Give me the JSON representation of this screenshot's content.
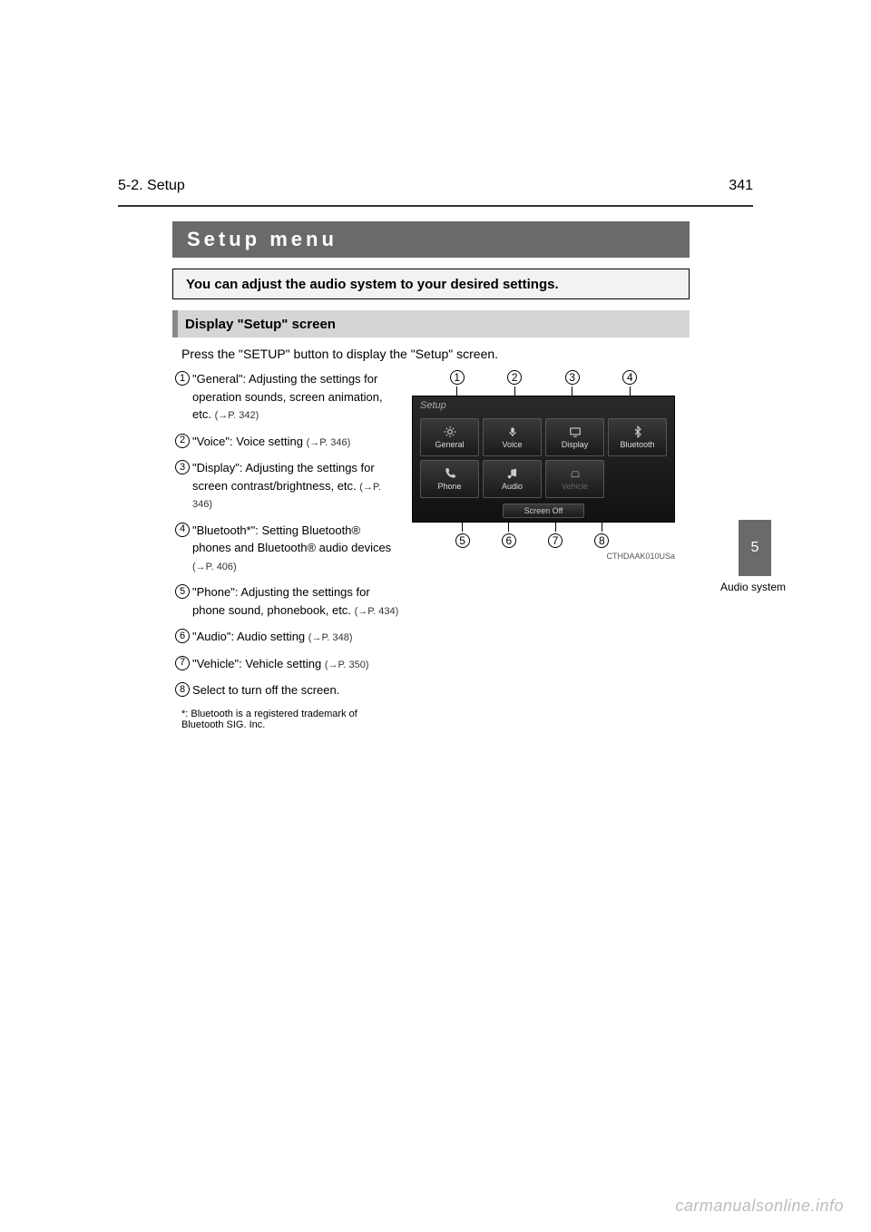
{
  "header": {
    "page_number": "341",
    "section": "5-2. Setup"
  },
  "title": "Setup menu",
  "intro": "You can adjust the audio system to your desired settings.",
  "section_heading": "Display \"Setup\" screen",
  "press_line": "Press the \"SETUP\" button to display the \"Setup\" screen.",
  "items": [
    {
      "n": "1",
      "text": "\"General\": Adjusting the settings for operation sounds, screen animation, etc.",
      "ref": "(→P. 342)"
    },
    {
      "n": "2",
      "text": "\"Voice\": Voice setting",
      "ref": "(→P. 346)"
    },
    {
      "n": "3",
      "text": "\"Display\": Adjusting the settings for screen contrast/brightness, etc.",
      "ref": "(→P. 346)"
    },
    {
      "n": "4",
      "text": "\"Bluetooth*\": Setting Bluetooth® phones and Bluetooth® audio devices",
      "ref": "(→P. 406)"
    },
    {
      "n": "5",
      "text": "\"Phone\": Adjusting the settings for phone sound, phonebook, etc.",
      "ref": "(→P. 434)"
    },
    {
      "n": "6",
      "text": "\"Audio\": Audio setting",
      "ref": "(→P. 348)"
    },
    {
      "n": "7",
      "text": "\"Vehicle\": Vehicle setting",
      "ref": "(→P. 350)"
    },
    {
      "n": "8",
      "text": "Select to turn off the screen.",
      "ref": ""
    }
  ],
  "footnote": "*: Bluetooth is a registered trademark of Bluetooth SIG. Inc.",
  "screenshot": {
    "title": "Setup",
    "cells": [
      "General",
      "Voice",
      "Display",
      "Bluetooth",
      "Phone",
      "Audio",
      "Vehicle",
      ""
    ],
    "screen_off": "Screen Off",
    "callouts_top": [
      "1",
      "2",
      "3",
      "4"
    ],
    "callouts_bot": [
      "5",
      "6",
      "7",
      "8"
    ],
    "code": "CTHDAAK010USa"
  },
  "side_tab": {
    "number": "5",
    "label": "Audio system"
  },
  "watermark": "carmanualsonline.info"
}
